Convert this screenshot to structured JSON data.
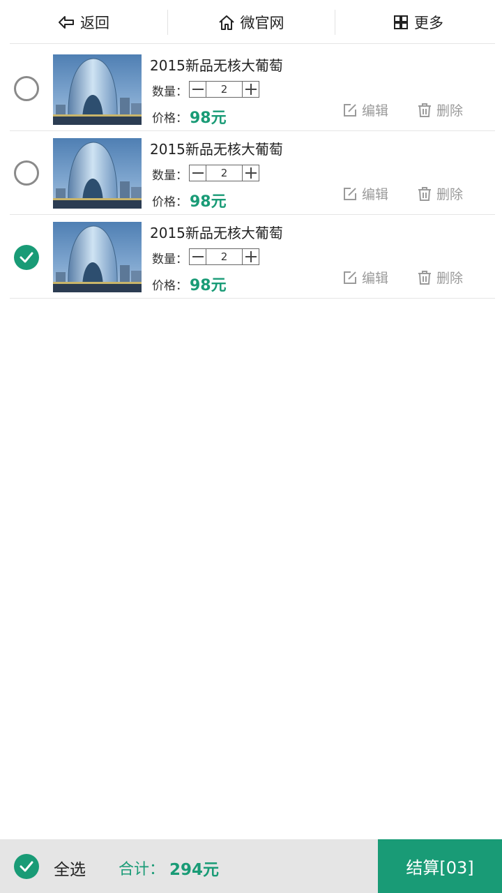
{
  "nav": {
    "back_label": "返回",
    "home_label": "微官网",
    "more_label": "更多"
  },
  "cart": {
    "items": [
      {
        "title": "2015新品无核大葡萄",
        "qty_label": "数量：",
        "qty": "2",
        "price_label": "价格：",
        "price": "98元",
        "edit_label": "编辑",
        "delete_label": "删除",
        "checked": false
      },
      {
        "title": "2015新品无核大葡萄",
        "qty_label": "数量：",
        "qty": "2",
        "price_label": "价格：",
        "price": "98元",
        "edit_label": "编辑",
        "delete_label": "删除",
        "checked": false
      },
      {
        "title": "2015新品无核大葡萄",
        "qty_label": "数量：",
        "qty": "2",
        "price_label": "价格：",
        "price": "98元",
        "edit_label": "编辑",
        "delete_label": "删除",
        "checked": true
      }
    ]
  },
  "footer": {
    "select_all_label": "全选",
    "total_label": "合计：",
    "total_value": "294元",
    "checkout_label": "结算[03]"
  },
  "colors": {
    "accent": "#199b76",
    "bottom_bar": "#e5e5e5",
    "muted": "#9a9a9a"
  }
}
